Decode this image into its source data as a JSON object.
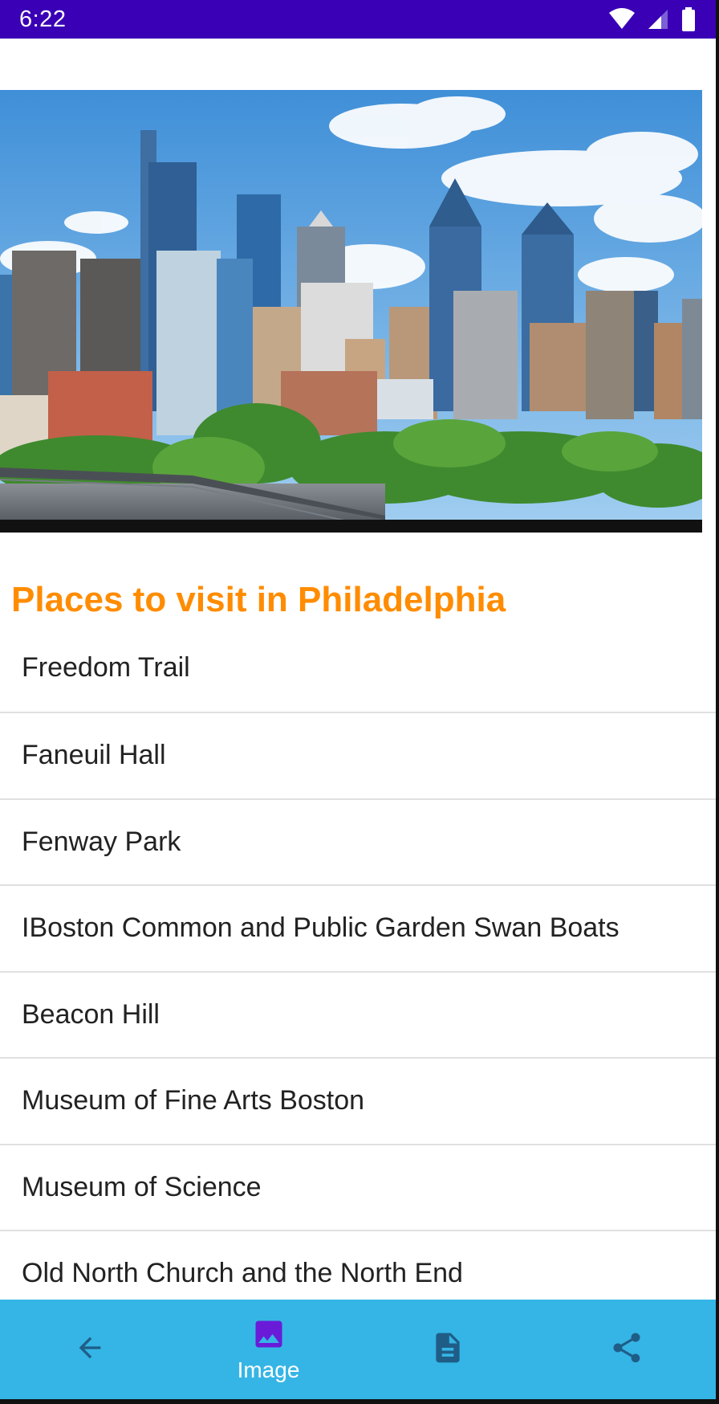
{
  "status_bar": {
    "time": "6:22",
    "icons": [
      "wifi-icon",
      "signal-icon",
      "battery-icon"
    ],
    "background": "#3a00b5"
  },
  "hero": {
    "image": "philadelphia-skyline-photo"
  },
  "section": {
    "title": "Places to visit in Philadelphia",
    "title_color": "#ff8c00"
  },
  "places": [
    "Freedom Trail",
    "Faneuil Hall",
    "Fenway Park",
    "IBoston Common and Public Garden Swan Boats",
    "Beacon Hill",
    "Museum of Fine Arts Boston",
    "Museum of Science",
    "Old North Church and the North End"
  ],
  "bottom_nav": {
    "background": "#35b5e5",
    "items": [
      {
        "icon": "arrow-back-icon",
        "label": ""
      },
      {
        "icon": "image-icon",
        "label": "Image",
        "selected": true
      },
      {
        "icon": "document-icon",
        "label": ""
      },
      {
        "icon": "share-icon",
        "label": ""
      }
    ]
  }
}
